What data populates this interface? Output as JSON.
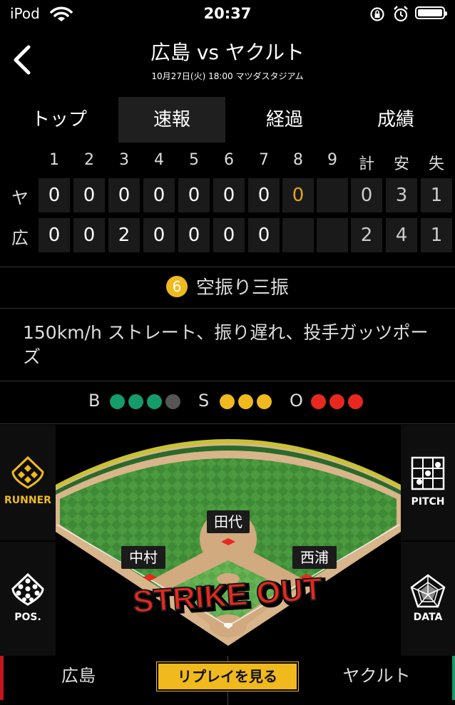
{
  "status_bar": {
    "carrier": "iPod",
    "time": "20:37"
  },
  "header": {
    "title": "広島 vs ヤクルト",
    "subtitle": "10月27日(火) 18:00 マツダスタジアム"
  },
  "tabs": [
    {
      "label": "トップ",
      "active": false
    },
    {
      "label": "速報",
      "active": true
    },
    {
      "label": "経過",
      "active": false
    },
    {
      "label": "成績",
      "active": false
    }
  ],
  "scoreboard": {
    "innings": [
      "1",
      "2",
      "3",
      "4",
      "5",
      "6",
      "7",
      "8",
      "9"
    ],
    "totals_headers": [
      "計",
      "安",
      "失"
    ],
    "rows": [
      {
        "team": "ヤ",
        "innings": [
          "0",
          "0",
          "0",
          "0",
          "0",
          "0",
          "0",
          "0",
          ""
        ],
        "totals": [
          "0",
          "3",
          "1"
        ]
      },
      {
        "team": "広",
        "innings": [
          "0",
          "0",
          "2",
          "0",
          "0",
          "0",
          "0",
          "",
          ""
        ],
        "totals": [
          "2",
          "4",
          "1"
        ]
      }
    ]
  },
  "play": {
    "number": "6",
    "result": "空振り三振"
  },
  "description": "150km/h ストレート、振り遅れ、投手ガッツポーズ",
  "count": {
    "balls_label": "B",
    "balls": 3,
    "balls_max": 4,
    "strikes_label": "S",
    "strikes": 3,
    "outs_label": "O",
    "outs": 3,
    "colors": {
      "ball": "#169b6b",
      "ball_off": "#555555",
      "strike": "#f0b91e",
      "out": "#e8281e"
    }
  },
  "field": {
    "runners": [
      {
        "name": "田代"
      },
      {
        "name": "中村"
      },
      {
        "name": "西浦"
      }
    ],
    "overlay_text": "STRIKE OUT"
  },
  "side_buttons": {
    "runner": "RUNNER",
    "pos": "POS.",
    "pitch": "PITCH",
    "data": "DATA"
  },
  "footer": {
    "home_team": "広島",
    "replay": "リプレイを見る",
    "away_team": "ヤクルト"
  },
  "colors": {
    "accent": "#f0b91e",
    "orange": "#e0a321",
    "red_bar": "#c4161c",
    "green_bar": "#169b6b"
  }
}
